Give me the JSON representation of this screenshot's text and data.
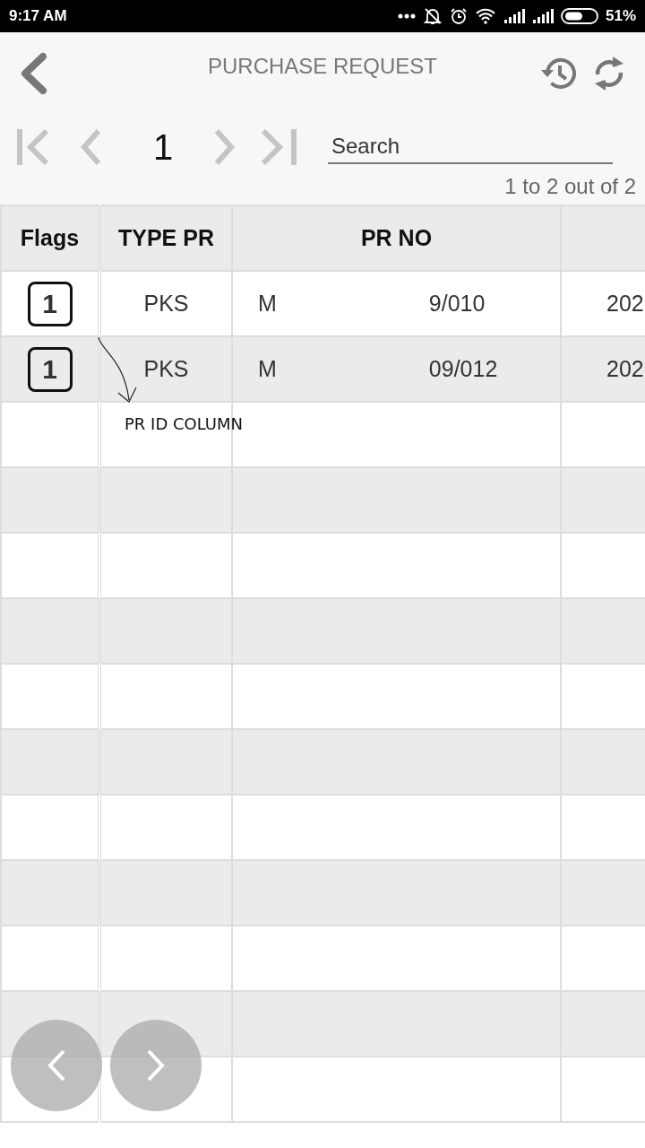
{
  "status_bar": {
    "time": "9:17 AM",
    "battery": "51%"
  },
  "header": {
    "title": "PURCHASE REQUEST"
  },
  "pager": {
    "page": "1",
    "search_placeholder": "Search",
    "range": "1 to 2 out of 2"
  },
  "table": {
    "columns": [
      "Flags",
      "TYPE PR",
      "PR NO"
    ],
    "rows": [
      {
        "flag": "1",
        "type_pr": "PKS",
        "pr_no_start": "M",
        "pr_no_end": "9/010",
        "column_4": "202"
      },
      {
        "flag": "1",
        "type_pr": "PKS",
        "pr_no_start": "M",
        "pr_no_end": "09/012",
        "column_4": "202"
      }
    ]
  },
  "annotation": {
    "label": "PR ID COLUMN"
  }
}
